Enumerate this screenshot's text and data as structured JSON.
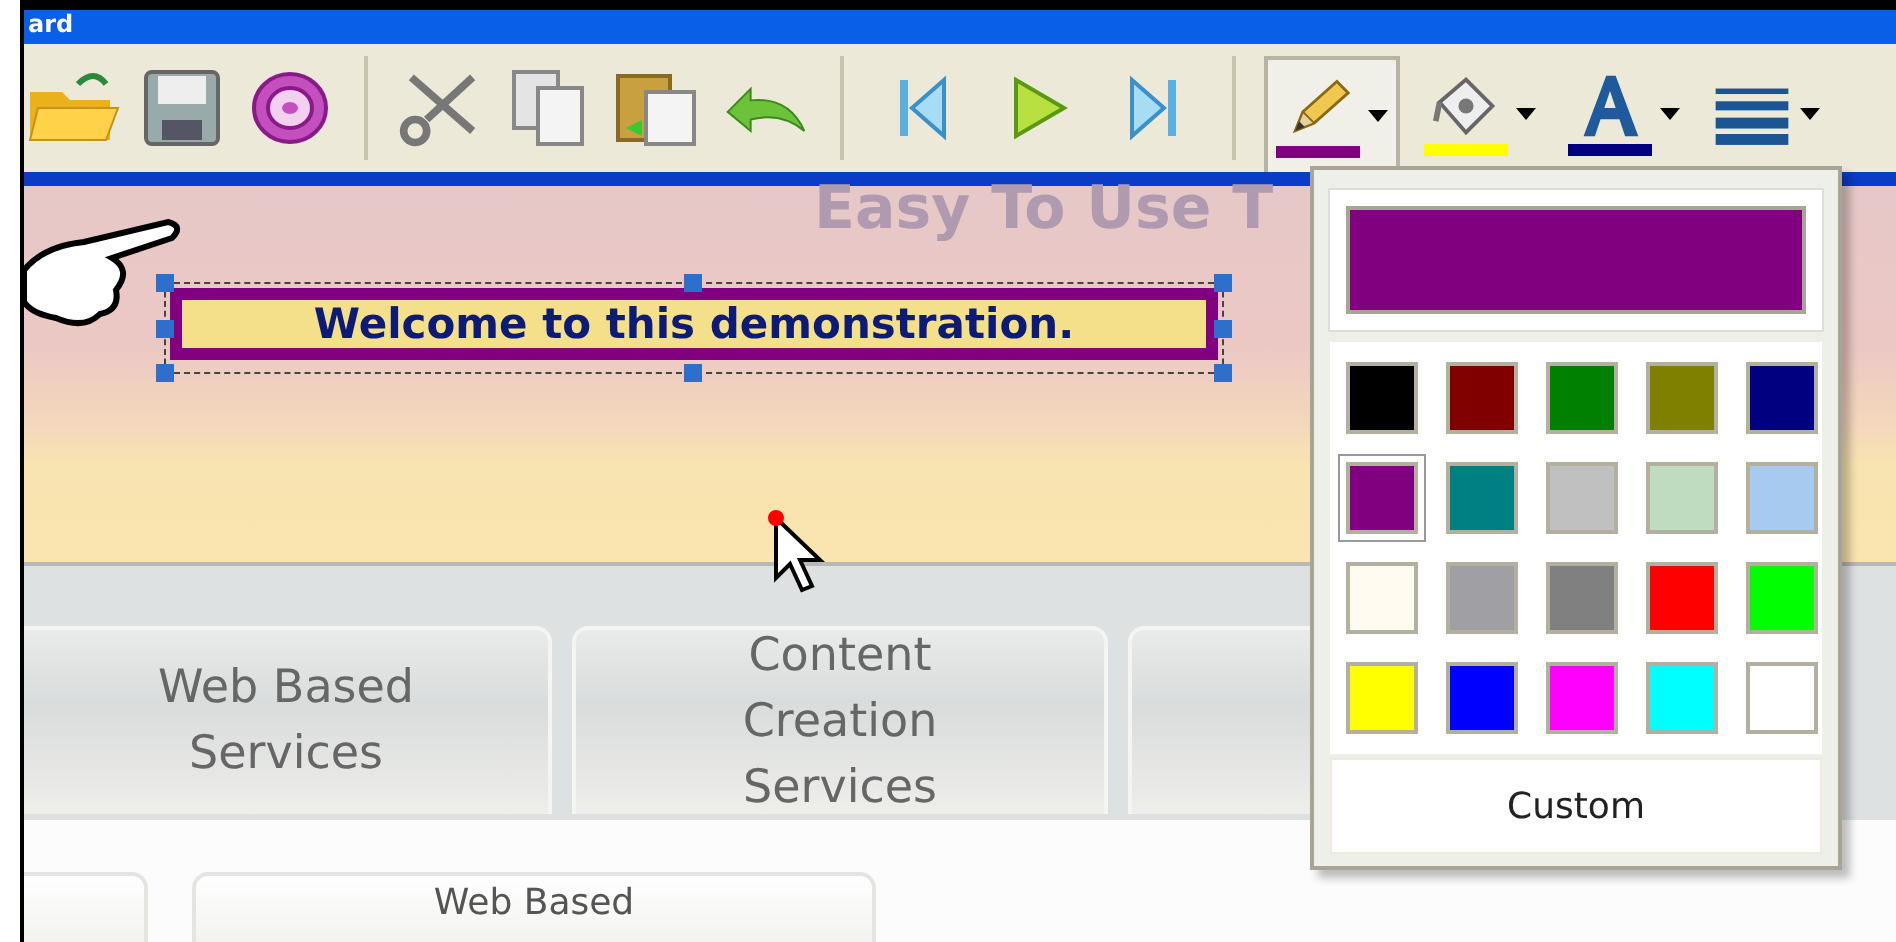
{
  "window": {
    "title": "ard"
  },
  "toolbar": [
    {
      "kind": "folder"
    },
    {
      "kind": "save"
    },
    {
      "kind": "disc"
    },
    {
      "kind": "separator"
    },
    {
      "kind": "scissors"
    },
    {
      "kind": "copy"
    },
    {
      "kind": "paste"
    },
    {
      "kind": "undo"
    },
    {
      "kind": "separator"
    },
    {
      "kind": "first"
    },
    {
      "kind": "play"
    },
    {
      "kind": "last"
    },
    {
      "kind": "separator"
    },
    {
      "kind": "pencil",
      "color": "#800080",
      "selected": true
    },
    {
      "kind": "bucket",
      "color": "#ffff00",
      "selected": false
    },
    {
      "kind": "font",
      "color": "#000080",
      "selected": false
    },
    {
      "kind": "lines",
      "selected": false
    }
  ],
  "banner": {
    "heading": "Easy To Use T",
    "text_box": "Welcome to this demonstration."
  },
  "tabs": [
    {
      "label": "Web Based Services"
    },
    {
      "label": "Content Creation Services"
    }
  ],
  "sub_tabs": [
    {
      "label": "Web Based"
    }
  ],
  "color_popup": {
    "preview": {
      "color": "#800080"
    },
    "custom_button": "Custom",
    "swatches": [
      {
        "color": "#000000",
        "selected": false
      },
      {
        "color": "#800000",
        "selected": false
      },
      {
        "color": "#008000",
        "selected": false
      },
      {
        "color": "#808000",
        "selected": false
      },
      {
        "color": "#000080",
        "selected": false
      },
      {
        "color": "#800080",
        "selected": true
      },
      {
        "color": "#008080",
        "selected": false
      },
      {
        "color": "#c0c0c0",
        "selected": false
      },
      {
        "color": "#c0dcc0",
        "selected": false
      },
      {
        "color": "#a6caf0",
        "selected": false
      },
      {
        "color": "#fffbf0",
        "selected": false
      },
      {
        "color": "#a0a0a4",
        "selected": false
      },
      {
        "color": "#808080",
        "selected": false
      },
      {
        "color": "#ff0000",
        "selected": false
      },
      {
        "color": "#00ff00",
        "selected": false
      },
      {
        "color": "#ffff00",
        "selected": false
      },
      {
        "color": "#0000ff",
        "selected": false
      },
      {
        "color": "#ff00ff",
        "selected": false
      },
      {
        "color": "#00ffff",
        "selected": false
      },
      {
        "color": "#ffffff",
        "selected": false
      }
    ]
  }
}
